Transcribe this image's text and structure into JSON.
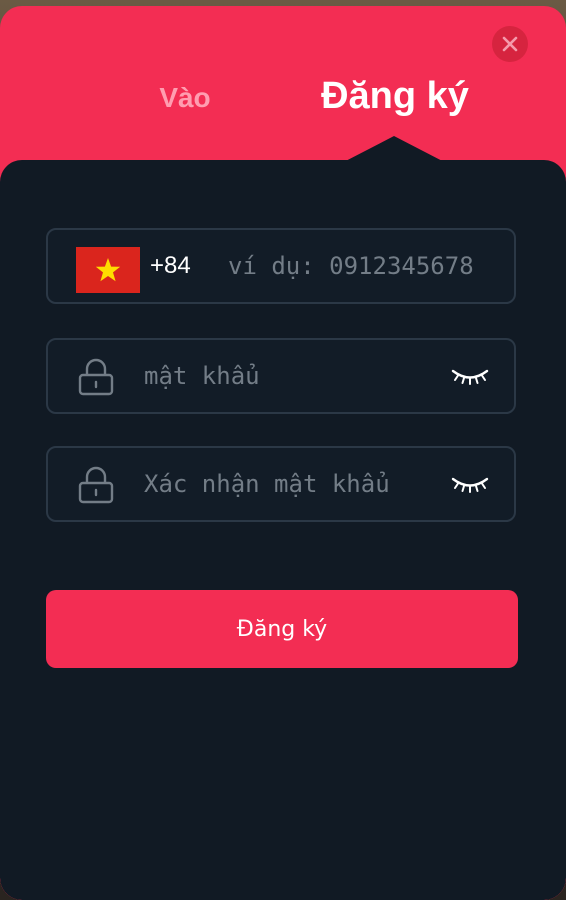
{
  "tabs": {
    "login_label": "Vào",
    "register_label": "Đăng ký"
  },
  "phone": {
    "dial_code": "+84",
    "placeholder": "ví dụ: 0912345678",
    "flag_country": "Vietnam"
  },
  "password": {
    "placeholder": "mật khẩu"
  },
  "confirm_password": {
    "placeholder": "Xác nhận mật khẩu"
  },
  "submit": {
    "label": "Đăng ký"
  },
  "colors": {
    "brand": "#f32d53",
    "panel": "#111a24",
    "field_border": "#2b3846",
    "placeholder": "#737d87",
    "inactive_tab": "#ff9db0"
  },
  "icons": {
    "close": "close-icon",
    "lock": "lock-icon",
    "eye_closed": "eye-closed-icon",
    "flag": "vietnam-flag-icon"
  }
}
